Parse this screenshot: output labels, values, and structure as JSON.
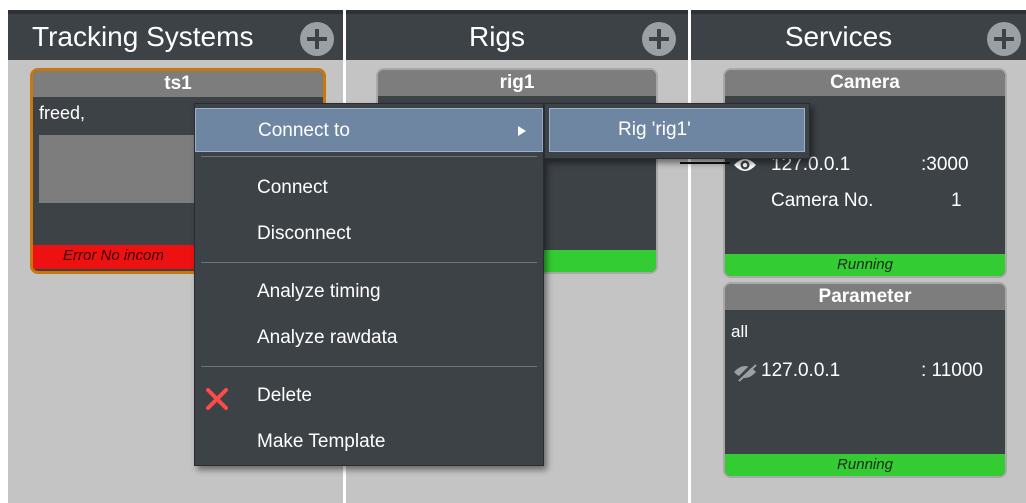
{
  "columns": {
    "tracking": {
      "title": "Tracking Systems"
    },
    "rigs": {
      "title": "Rigs"
    },
    "services": {
      "title": "Services"
    }
  },
  "cards": {
    "ts1": {
      "title": "ts1",
      "subtitle": "freed,",
      "status": "Error No incom",
      "status_color": "#ee1111"
    },
    "rig1": {
      "title": "rig1",
      "status_color": "#33cc33"
    },
    "camera": {
      "title": "Camera",
      "address": "127.0.0.1",
      "port": ":3000",
      "camera_label": "Camera No.",
      "camera_no": "1",
      "status": "Running",
      "icon": "eye-icon"
    },
    "parameter": {
      "title": "Parameter",
      "subtitle": "all",
      "address": "127.0.0.1",
      "port": ": 11000",
      "status": "Running",
      "icon": "eye-off-icon"
    }
  },
  "context_menu": {
    "items": [
      {
        "label": "Connect to",
        "has_submenu": true
      },
      {
        "label": "Connect"
      },
      {
        "label": "Disconnect"
      },
      {
        "label": "Analyze timing"
      },
      {
        "label": "Analyze rawdata"
      },
      {
        "label": "Delete",
        "icon": "delete-x-icon"
      },
      {
        "label": "Make Template"
      }
    ],
    "submenu": {
      "items": [
        {
          "label": "Rig 'rig1'"
        }
      ]
    }
  },
  "colors": {
    "panel_bg": "#3d4246",
    "highlight": "#6f86a3",
    "running": "#33cc33",
    "error": "#ee1111",
    "selected_border": "#c8780a"
  }
}
